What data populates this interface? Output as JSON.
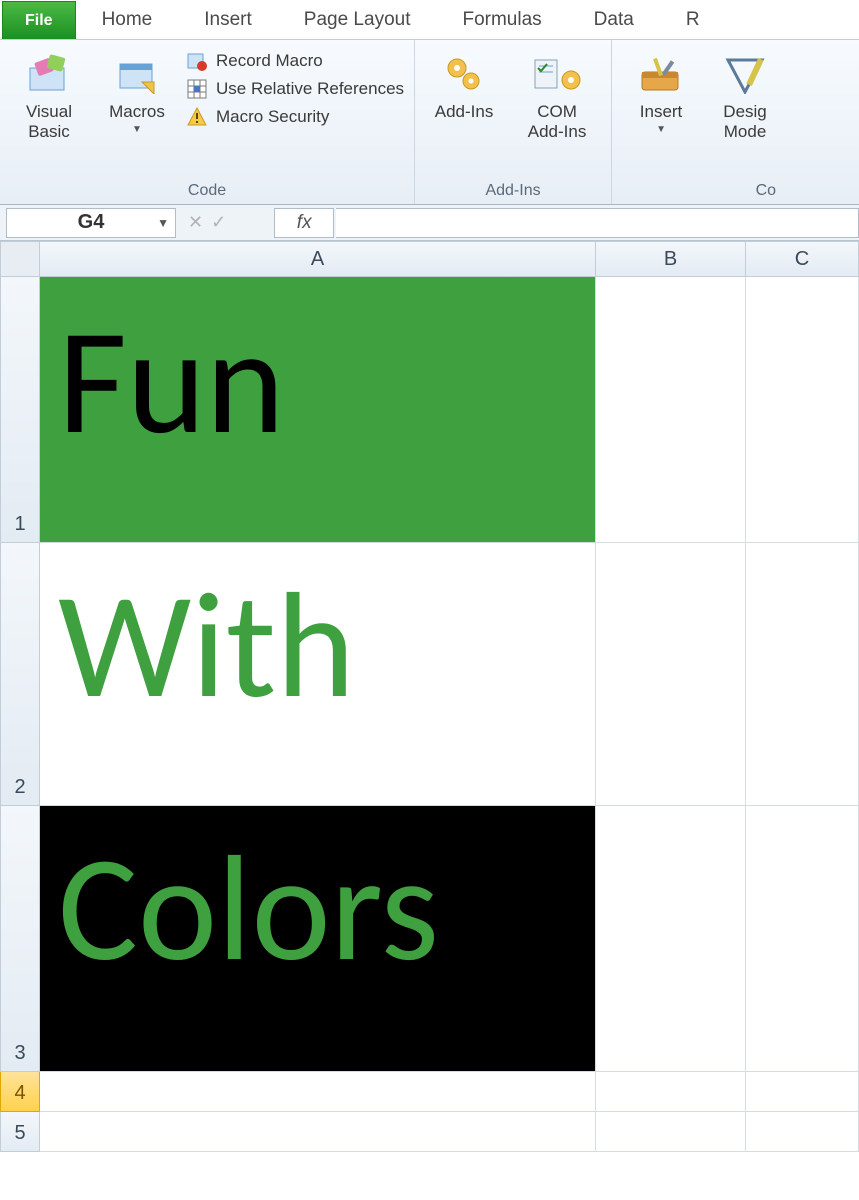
{
  "tabs": {
    "file": "File",
    "items": [
      "Home",
      "Insert",
      "Page Layout",
      "Formulas",
      "Data",
      "R"
    ]
  },
  "ribbon": {
    "code": {
      "visual_basic": "Visual\nBasic",
      "macros": "Macros",
      "record_macro": "Record Macro",
      "use_relative": "Use Relative References",
      "macro_security": "Macro Security",
      "label": "Code"
    },
    "addins": {
      "addins": "Add-Ins",
      "com_addins": "COM\nAdd-Ins",
      "label": "Add-Ins"
    },
    "controls": {
      "insert": "Insert",
      "design_mode": "Desig\nMode",
      "label": "Co"
    }
  },
  "formula_bar": {
    "name_box": "G4",
    "fx": "fx",
    "value": ""
  },
  "columns": [
    "A",
    "B",
    "C"
  ],
  "rows": [
    "1",
    "2",
    "3",
    "4",
    "5"
  ],
  "cells": {
    "A1": {
      "text": "Fun",
      "bg": "#3fa03f",
      "fg": "#000000"
    },
    "A2": {
      "text": "With",
      "bg": "#ffffff",
      "fg": "#3fa03f"
    },
    "A3": {
      "text": "Colors",
      "bg": "#000000",
      "fg": "#3fa03f"
    }
  },
  "selected_row": "4"
}
